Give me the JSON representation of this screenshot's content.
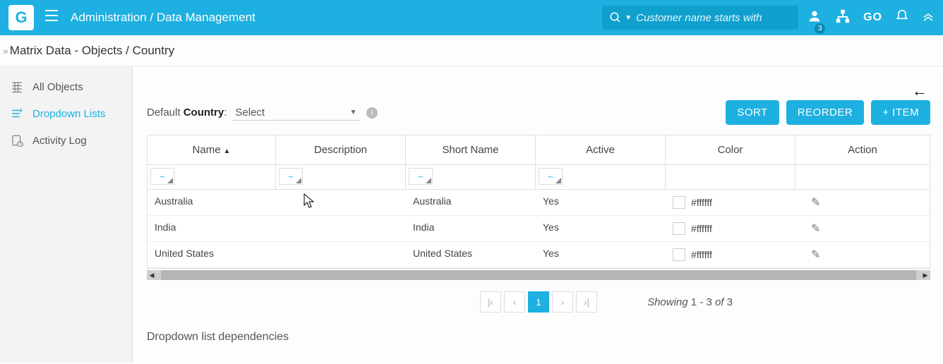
{
  "topbar": {
    "logo": "G",
    "breadcrumb": "Administration / Data Management",
    "search_placeholder": "Customer name starts with",
    "go_label": "GO",
    "badge_count": "3"
  },
  "subheader": {
    "path": "Matrix Data - Objects / Country"
  },
  "sidebar": {
    "items": [
      {
        "label": "All Objects"
      },
      {
        "label": "Dropdown Lists"
      },
      {
        "label": "Activity Log"
      }
    ]
  },
  "controls": {
    "default_prefix": "Default ",
    "default_bold": "Country",
    "default_suffix": ":",
    "select_placeholder": "Select",
    "sort_btn": "SORT",
    "reorder_btn": "REORDER",
    "add_btn": "+ ITEM"
  },
  "grid": {
    "headers": {
      "name": "Name",
      "description": "Description",
      "short_name": "Short Name",
      "active": "Active",
      "color": "Color",
      "action": "Action"
    },
    "filter_glyph": "~",
    "rows": [
      {
        "name": "Australia",
        "desc": "",
        "short": "Australia",
        "active": "Yes",
        "color": "#ffffff"
      },
      {
        "name": "India",
        "desc": "",
        "short": "India",
        "active": "Yes",
        "color": "#ffffff"
      },
      {
        "name": "United States",
        "desc": "",
        "short": "United States",
        "active": "Yes",
        "color": "#ffffff"
      }
    ]
  },
  "pager": {
    "current": "1",
    "showing_prefix": "Showing ",
    "showing_range": "1 - 3",
    "showing_mid": " of ",
    "showing_total": "3"
  },
  "deps": {
    "title": "Dropdown list dependencies"
  }
}
